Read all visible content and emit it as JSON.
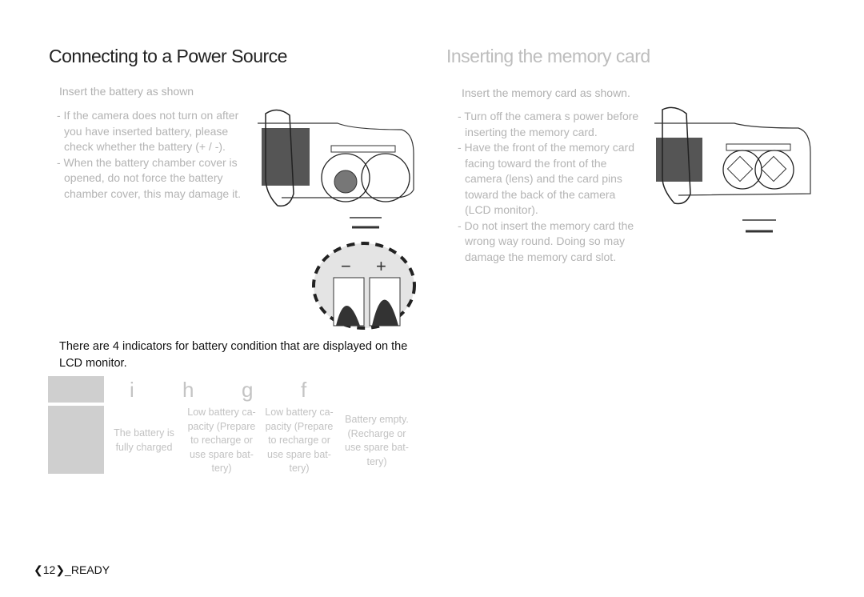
{
  "left": {
    "title": "Connecting to a Power Source",
    "intro": "Insert the battery as shown",
    "bullets": [
      "- If the camera does not turn on after you have inserted battery, please check whether the battery (+ / -).",
      "- When the battery chamber cover is opened, do not force the battery chamber cover, this may damage it."
    ],
    "polarity_minus": "−",
    "polarity_plus": "+",
    "indicator_note": "There are 4 indicators for battery condition that are displayed on the LCD monitor.",
    "indicators": [
      {
        "icon": "i",
        "description": "The battery is fully charged"
      },
      {
        "icon": "h",
        "description": "Low battery ca- pacity (Prepare to recharge or use spare bat- tery)"
      },
      {
        "icon": "g",
        "description": "Low battery ca- pacity (Prepare to recharge or use spare bat- tery)"
      },
      {
        "icon": "f",
        "description": "Battery empty. (Recharge or use spare bat- tery)"
      }
    ]
  },
  "right": {
    "title": "Inserting the memory card",
    "intro": "Insert the memory card as shown.",
    "bullets": [
      "- Turn off the camera s power before inserting the memory card.",
      "- Have the front of the memory card facing toward the front of the camera (lens) and the card pins toward the back of the camera (LCD monitor).",
      "- Do not insert the memory card the wrong way round. Doing so may damage the memory card slot."
    ]
  },
  "footer": {
    "page_number": "12",
    "section": "_READY"
  }
}
